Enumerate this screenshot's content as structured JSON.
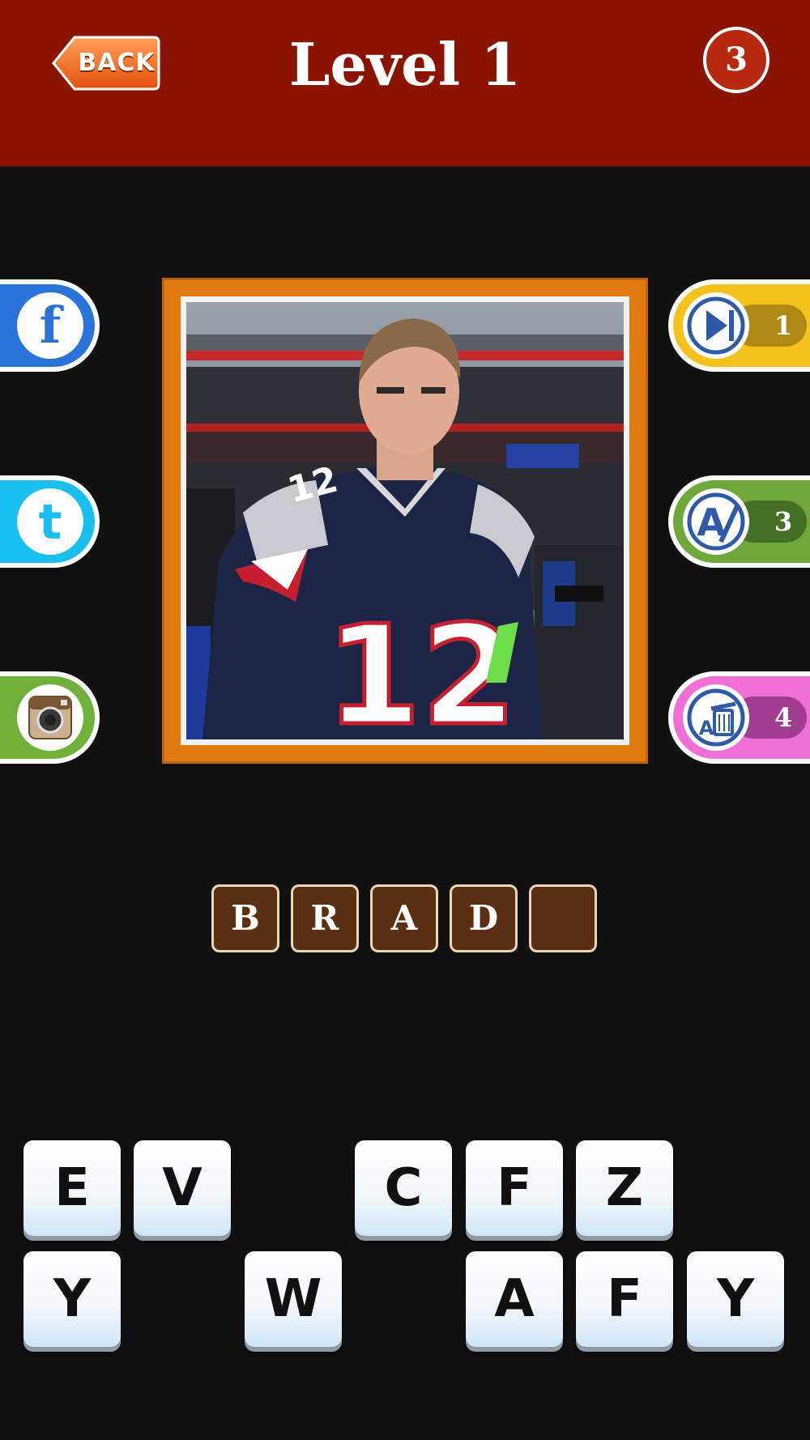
{
  "header": {
    "back_label": "BACK",
    "title": "Level 1",
    "coins": "3"
  },
  "share": [
    {
      "name": "facebook",
      "glyph": "f",
      "color": "#2a73d9"
    },
    {
      "name": "twitter",
      "glyph": "t",
      "color": "#1ec0f0"
    },
    {
      "name": "instagram",
      "glyph": "",
      "color": "#6fb13a"
    }
  ],
  "hints": [
    {
      "name": "skip-level",
      "count": "1",
      "color": "#f5c21c"
    },
    {
      "name": "reveal-letter",
      "count": "3",
      "color": "#6fa83a"
    },
    {
      "name": "remove-letters",
      "count": "4",
      "color": "#f070d8"
    }
  ],
  "photo": {
    "jersey_number": "12"
  },
  "answer": {
    "slots": [
      "B",
      "R",
      "A",
      "D",
      ""
    ]
  },
  "keyboard": {
    "row1": [
      "E",
      "V",
      "",
      "C",
      "F",
      "Z",
      ""
    ],
    "row2": [
      "Y",
      "",
      "W",
      "",
      "A",
      "F",
      "Y"
    ]
  }
}
